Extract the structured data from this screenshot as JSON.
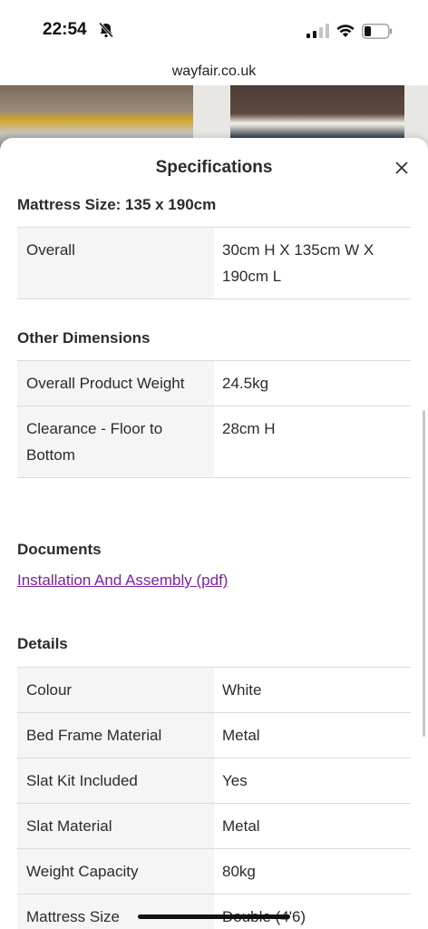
{
  "status_bar": {
    "time": "22:54"
  },
  "browser": {
    "url": "wayfair.co.uk"
  },
  "sheet": {
    "title": "Specifications",
    "mattress_size_heading": "Mattress Size: 135 x 190cm",
    "mattress_rows": [
      {
        "label": "Overall",
        "value": "30cm H X 135cm W X 190cm L"
      }
    ],
    "other_dimensions_heading": "Other Dimensions",
    "other_dimensions_rows": [
      {
        "label": "Overall Product Weight",
        "value": "24.5kg"
      },
      {
        "label": "Clearance - Floor to Bottom",
        "value": "28cm H"
      }
    ],
    "documents_heading": "Documents",
    "documents_link": "Installation And Assembly (pdf)",
    "details_heading": "Details",
    "details_rows": [
      {
        "label": "Colour",
        "value": "White"
      },
      {
        "label": "Bed Frame Material",
        "value": "Metal"
      },
      {
        "label": "Slat Kit Included",
        "value": "Yes"
      },
      {
        "label": "Slat Material",
        "value": "Metal"
      },
      {
        "label": "Weight Capacity",
        "value": "80kg"
      },
      {
        "label": "Mattress Size",
        "value": "Double (4'6)"
      }
    ]
  },
  "colors": {
    "link": "#7b1fa2",
    "label_bg": "#f5f5f5",
    "divider": "#dcdcdc"
  }
}
